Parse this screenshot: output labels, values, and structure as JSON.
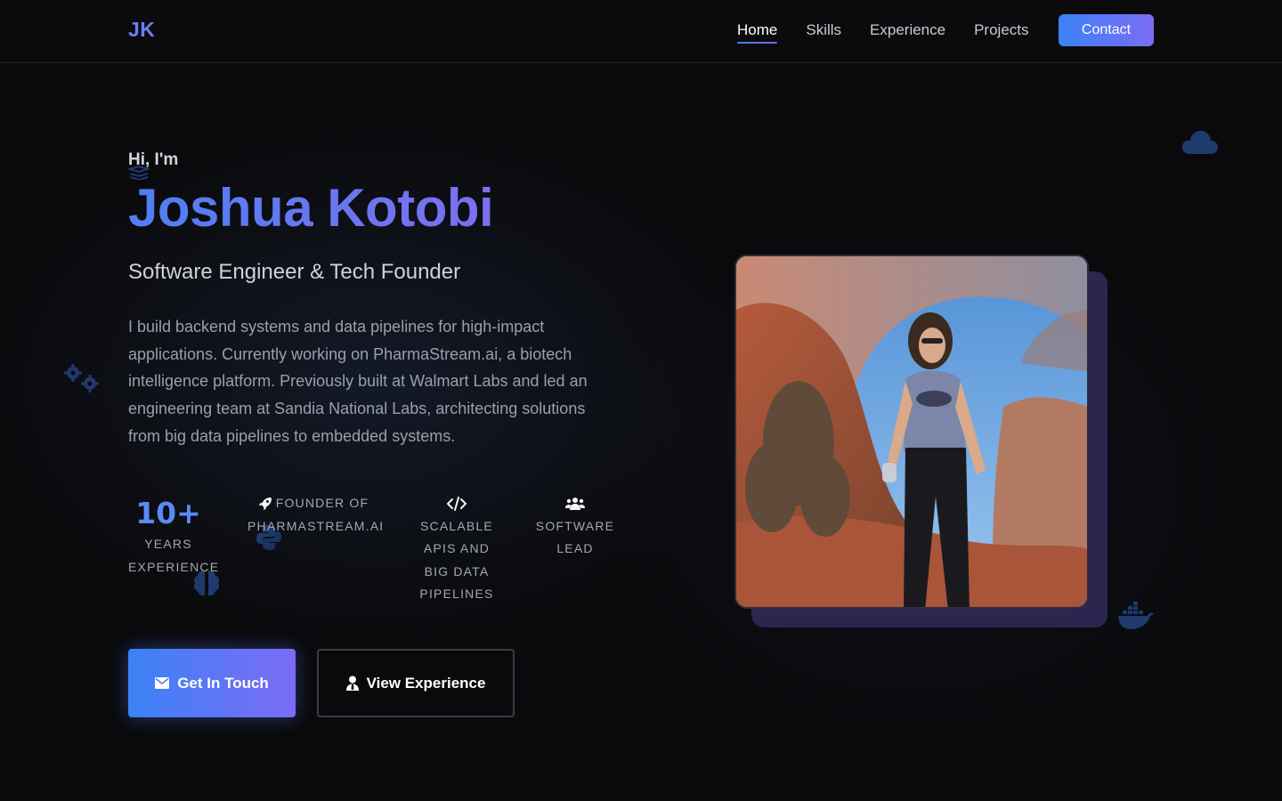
{
  "nav": {
    "logo": "JK",
    "links": [
      "Home",
      "Skills",
      "Experience",
      "Projects"
    ],
    "active_link": "Home",
    "contact_label": "Contact"
  },
  "hero": {
    "greeting": "Hi, I'm",
    "name": "Joshua Kotobi",
    "subtitle": "Software Engineer & Tech Founder",
    "bio": "I build backend systems and data pipelines for high-impact applications. Currently working on PharmaStream.ai, a biotech intelligence platform. Previously built at Walmart Labs and led an engineering team at Sandia National Labs, architecting solutions from big data pipelines to embedded systems."
  },
  "stats": [
    {
      "value": "10+",
      "label_lines": [
        "YEARS",
        "EXPERIENCE"
      ]
    },
    {
      "icon": "rocket-icon",
      "label_lines": [
        "FOUNDER OF",
        "PHARMASTREAM.AI"
      ]
    },
    {
      "icon": "code-icon",
      "label_lines": [
        "SCALABLE",
        "APIS AND",
        "BIG DATA",
        "PIPELINES"
      ]
    },
    {
      "icon": "users-icon",
      "label_lines": [
        "SOFTWARE",
        "LEAD"
      ]
    }
  ],
  "buttons": {
    "primary": "Get In Touch",
    "secondary": "View Experience"
  },
  "colors": {
    "accent_start": "#3b82f6",
    "accent_end": "#7c6cf5",
    "background": "#0a0a0c",
    "deco_icon": "#1e3a6e"
  }
}
